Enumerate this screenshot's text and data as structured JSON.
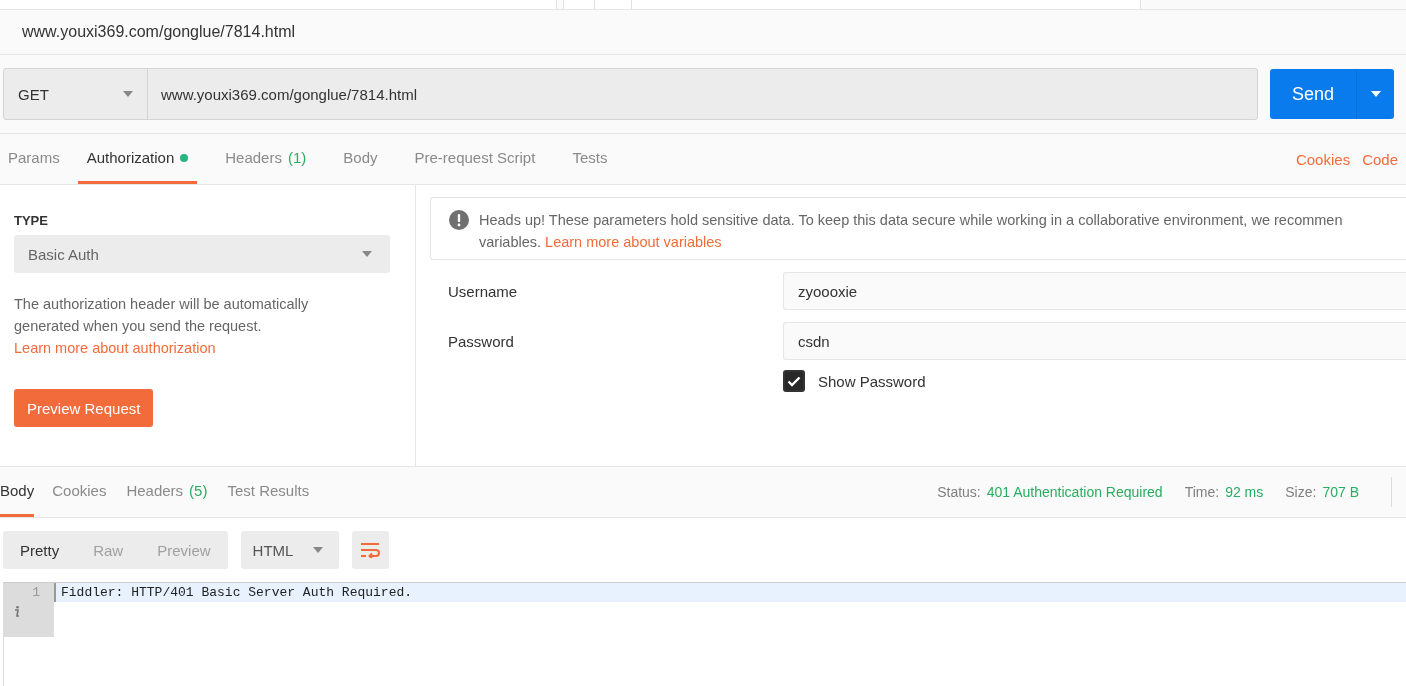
{
  "request_title": "www.youxi369.com/gonglue/7814.html",
  "method": "GET",
  "url": "www.youxi369.com/gonglue/7814.html",
  "send_label": "Send",
  "request_tabs": [
    {
      "label": "Params",
      "selected": false
    },
    {
      "label": "Authorization",
      "selected": true,
      "dot": true
    },
    {
      "label": "Headers",
      "count": "(1)",
      "selected": false
    },
    {
      "label": "Body",
      "selected": false
    },
    {
      "label": "Pre-request Script",
      "selected": false
    },
    {
      "label": "Tests",
      "selected": false
    }
  ],
  "request_links": [
    "Cookies",
    "Code"
  ],
  "auth": {
    "type_label": "TYPE",
    "type_value": "Basic Auth",
    "description": "The authorization header will be automatically generated when you send the request.",
    "description_link": "Learn more about authorization",
    "preview_button": "Preview Request",
    "notice": {
      "text": "Heads up! These parameters hold sensitive data. To keep this data secure while working in a collaborative environment, we recommen",
      "continuation": "variables.",
      "link": "Learn more about variables"
    },
    "fields": [
      {
        "label": "Username",
        "value": "zyoooxie"
      },
      {
        "label": "Password",
        "value": "csdn"
      }
    ],
    "show_password": {
      "label": "Show Password",
      "checked": true
    }
  },
  "response_tabs": [
    {
      "label": "Body",
      "selected": true
    },
    {
      "label": "Cookies",
      "selected": false
    },
    {
      "label": "Headers",
      "count": "(5)",
      "selected": false
    },
    {
      "label": "Test Results",
      "selected": false
    }
  ],
  "response_meta": [
    {
      "label": "Status:",
      "value": "401 Authentication Required"
    },
    {
      "label": "Time:",
      "value": "92 ms"
    },
    {
      "label": "Size:",
      "value": "707 B"
    }
  ],
  "view_modes": [
    {
      "label": "Pretty",
      "selected": true
    },
    {
      "label": "Raw",
      "selected": false
    },
    {
      "label": "Preview",
      "selected": false
    }
  ],
  "format": "HTML",
  "editor_lines": [
    {
      "number": "1",
      "text": "Fiddler: HTTP/401 Basic Server Auth Required."
    }
  ]
}
